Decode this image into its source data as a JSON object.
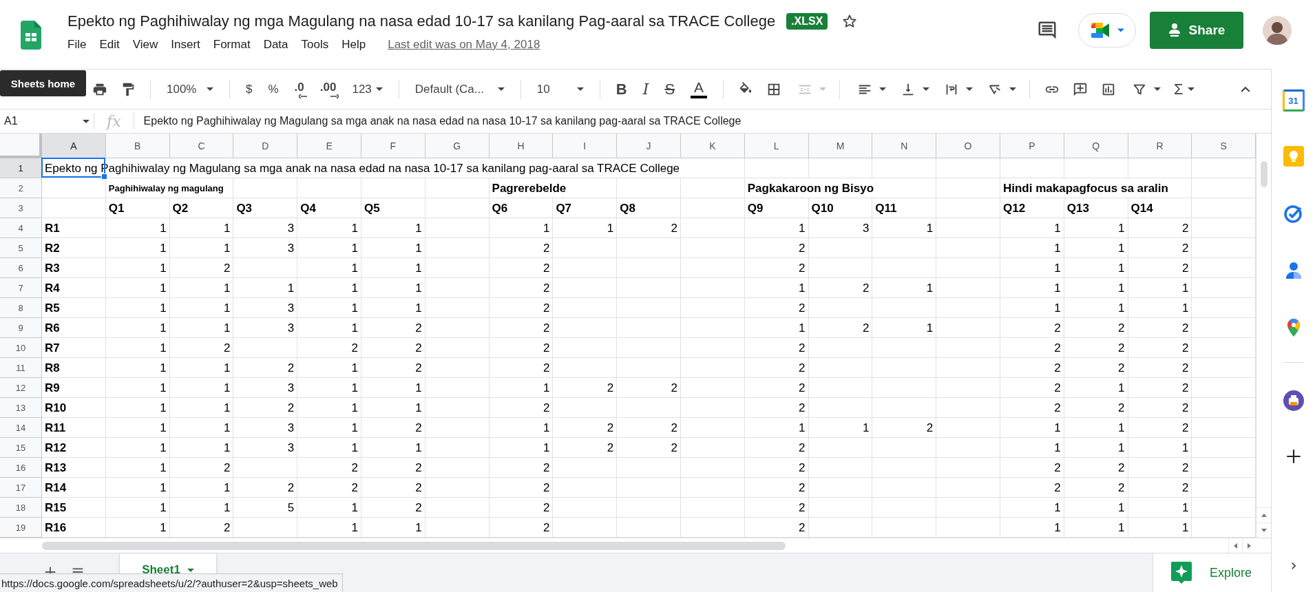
{
  "header": {
    "title": "Epekto ng Paghihiwalay ng mga Magulang na nasa edad 10-17 sa kanilang Pag-aaral sa TRACE College",
    "badge": ".XLSX",
    "starred": false,
    "menu": [
      "File",
      "Edit",
      "View",
      "Insert",
      "Format",
      "Data",
      "Tools",
      "Help"
    ],
    "last_edit": "Last edit was on May 4, 2018",
    "share": "Share"
  },
  "tooltip": "Sheets home",
  "toolbar": {
    "zoom": "100%",
    "currency": "$",
    "percent": "%",
    "decrease_decimal": ".0",
    "increase_decimal": ".00",
    "more_formats": "123",
    "font": "Default (Ca...",
    "font_size": "10",
    "bold": "B",
    "italic": "I",
    "strikethrough": "S",
    "text_color": "A",
    "merge_disabled": true,
    "functions": "Σ"
  },
  "formula_bar": {
    "name_box": "A1",
    "fx": "fx",
    "value": "Epekto ng Paghihiwalay ng Magulang sa mga anak na nasa edad na nasa 10-17 sa kanilang pag-aaral sa TRACE College"
  },
  "grid": {
    "columns": [
      {
        "label": "A",
        "selected": true
      },
      {
        "label": "B",
        "selected": false
      },
      {
        "label": "C",
        "selected": false
      },
      {
        "label": "D",
        "selected": false
      },
      {
        "label": "E",
        "selected": false
      },
      {
        "label": "F",
        "selected": false
      },
      {
        "label": "G",
        "selected": false
      },
      {
        "label": "H",
        "selected": false
      },
      {
        "label": "I",
        "selected": false
      },
      {
        "label": "J",
        "selected": false
      },
      {
        "label": "K",
        "selected": false
      },
      {
        "label": "L",
        "selected": false
      },
      {
        "label": "M",
        "selected": false
      },
      {
        "label": "N",
        "selected": false
      },
      {
        "label": "O",
        "selected": false
      },
      {
        "label": "P",
        "selected": false
      },
      {
        "label": "Q",
        "selected": false
      },
      {
        "label": "R",
        "selected": false
      },
      {
        "label": "S",
        "selected": false
      }
    ],
    "rows": [
      {
        "number": "1",
        "selected": true,
        "kind": "title",
        "cells": [
          {
            "text": "Epekto ng Paghihiwalay ng Magulang sa mga anak na nasa edad na nasa 10-17 sa kanilang pag-aaral sa TRACE College",
            "selected": true
          },
          null,
          null,
          null,
          null,
          null,
          null,
          null,
          null,
          null,
          null,
          null,
          null,
          null,
          null,
          null,
          null,
          null,
          null
        ]
      },
      {
        "number": "2",
        "selected": false,
        "kind": "section",
        "cells": [
          null,
          {
            "text": "Paghihiwalay ng magulang",
            "small": true
          },
          null,
          null,
          null,
          null,
          null,
          {
            "text": "Pagrerebelde",
            "small": false
          },
          null,
          null,
          null,
          {
            "text": "Pagkakaroon ng Bisyo",
            "small": false
          },
          null,
          null,
          null,
          {
            "text": "Hindi makapagfocus sa aralin",
            "small": false
          },
          null,
          null,
          null
        ]
      },
      {
        "number": "3",
        "selected": false,
        "kind": "header",
        "cells": [
          null,
          "Q1",
          "Q2",
          "Q3",
          "Q4",
          "Q5",
          null,
          "Q6",
          "Q7",
          "Q8",
          null,
          "Q9",
          "Q10",
          "Q11",
          null,
          "Q12",
          "Q13",
          "Q14",
          null
        ]
      },
      {
        "number": "4",
        "selected": false,
        "kind": "data",
        "cells": [
          "R1",
          "1",
          "1",
          "3",
          "1",
          "1",
          null,
          "1",
          "1",
          "2",
          null,
          "1",
          "3",
          "1",
          null,
          "1",
          "1",
          "2",
          null
        ]
      },
      {
        "number": "5",
        "selected": false,
        "kind": "data",
        "cells": [
          "R2",
          "1",
          "1",
          "3",
          "1",
          "1",
          null,
          "2",
          null,
          null,
          null,
          "2",
          null,
          null,
          null,
          "1",
          "1",
          "2",
          null
        ]
      },
      {
        "number": "6",
        "selected": false,
        "kind": "data",
        "cells": [
          "R3",
          "1",
          "2",
          null,
          "1",
          "1",
          null,
          "2",
          null,
          null,
          null,
          "2",
          null,
          null,
          null,
          "1",
          "1",
          "2",
          null
        ]
      },
      {
        "number": "7",
        "selected": false,
        "kind": "data",
        "cells": [
          "R4",
          "1",
          "1",
          "1",
          "1",
          "1",
          null,
          "2",
          null,
          null,
          null,
          "1",
          "2",
          "1",
          null,
          "1",
          "1",
          "1",
          null
        ]
      },
      {
        "number": "8",
        "selected": false,
        "kind": "data",
        "cells": [
          "R5",
          "1",
          "1",
          "3",
          "1",
          "1",
          null,
          "2",
          null,
          null,
          null,
          "2",
          null,
          null,
          null,
          "1",
          "1",
          "1",
          null
        ]
      },
      {
        "number": "9",
        "selected": false,
        "kind": "data",
        "cells": [
          "R6",
          "1",
          "1",
          "3",
          "1",
          "2",
          null,
          "2",
          null,
          null,
          null,
          "1",
          "2",
          "1",
          null,
          "2",
          "2",
          "2",
          null
        ]
      },
      {
        "number": "10",
        "selected": false,
        "kind": "data",
        "cells": [
          "R7",
          "1",
          "2",
          null,
          "2",
          "2",
          null,
          "2",
          null,
          null,
          null,
          "2",
          null,
          null,
          null,
          "2",
          "2",
          "2",
          null
        ]
      },
      {
        "number": "11",
        "selected": false,
        "kind": "data",
        "cells": [
          "R8",
          "1",
          "1",
          "2",
          "1",
          "2",
          null,
          "2",
          null,
          null,
          null,
          "2",
          null,
          null,
          null,
          "2",
          "2",
          "2",
          null
        ]
      },
      {
        "number": "12",
        "selected": false,
        "kind": "data",
        "cells": [
          "R9",
          "1",
          "1",
          "3",
          "1",
          "1",
          null,
          "1",
          "2",
          "2",
          null,
          "2",
          null,
          null,
          null,
          "2",
          "1",
          "2",
          null
        ]
      },
      {
        "number": "13",
        "selected": false,
        "kind": "data",
        "cells": [
          "R10",
          "1",
          "1",
          "2",
          "1",
          "1",
          null,
          "2",
          null,
          null,
          null,
          "2",
          null,
          null,
          null,
          "2",
          "2",
          "2",
          null
        ]
      },
      {
        "number": "14",
        "selected": false,
        "kind": "data",
        "cells": [
          "R11",
          "1",
          "1",
          "3",
          "1",
          "2",
          null,
          "1",
          "2",
          "2",
          null,
          "1",
          "1",
          "2",
          null,
          "1",
          "1",
          "2",
          null
        ]
      },
      {
        "number": "15",
        "selected": false,
        "kind": "data",
        "cells": [
          "R12",
          "1",
          "1",
          "3",
          "1",
          "1",
          null,
          "1",
          "2",
          "2",
          null,
          "2",
          null,
          null,
          null,
          "1",
          "1",
          "1",
          null
        ]
      },
      {
        "number": "16",
        "selected": false,
        "kind": "data",
        "cells": [
          "R13",
          "1",
          "2",
          null,
          "2",
          "2",
          null,
          "2",
          null,
          null,
          null,
          "2",
          null,
          null,
          null,
          "2",
          "2",
          "2",
          null
        ]
      },
      {
        "number": "17",
        "selected": false,
        "kind": "data",
        "cells": [
          "R14",
          "1",
          "1",
          "2",
          "2",
          "2",
          null,
          "2",
          null,
          null,
          null,
          "2",
          null,
          null,
          null,
          "2",
          "2",
          "2",
          null
        ]
      },
      {
        "number": "18",
        "selected": false,
        "kind": "data",
        "cells": [
          "R15",
          "1",
          "1",
          "5",
          "1",
          "2",
          null,
          "2",
          null,
          null,
          null,
          "2",
          null,
          null,
          null,
          "1",
          "1",
          "1",
          null
        ]
      },
      {
        "number": "19",
        "selected": false,
        "kind": "data",
        "cells": [
          "R16",
          "1",
          "2",
          null,
          "1",
          "1",
          null,
          "2",
          null,
          null,
          null,
          "2",
          null,
          null,
          null,
          "1",
          "1",
          "1",
          null
        ]
      }
    ]
  },
  "side_panel": {
    "calendar_day": "31"
  },
  "sheet_tabs": [
    {
      "label": "Sheet1",
      "selected": true
    }
  ],
  "explore": "Explore",
  "status_url": "https://docs.google.com/spreadsheets/u/2/?authuser=2&usp=sheets_web"
}
